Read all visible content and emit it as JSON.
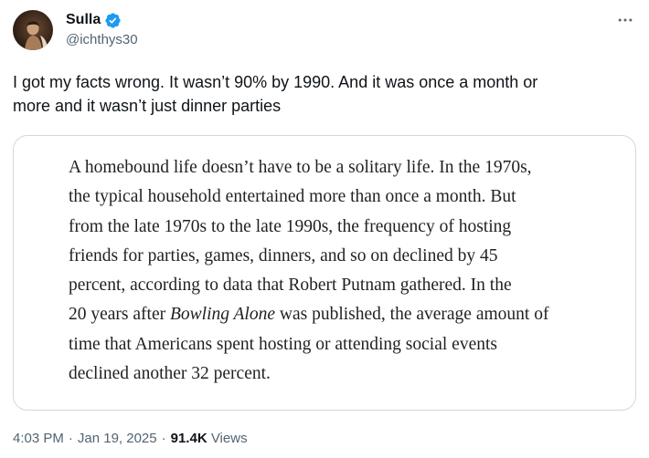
{
  "author": {
    "display_name": "Sulla",
    "handle": "@ichthys30",
    "verified_icon": "verified-badge-icon",
    "verified_color": "#1d9bf0"
  },
  "tweet": {
    "text_line_1": "I got my facts wrong. It wasn’t 90% by 1990. And it was once a month or",
    "text_line_2": "more and it wasn’t just dinner parties"
  },
  "media": {
    "excerpt_lines": [
      "A homebound life doesn’t have to be a solitary life. In the 1970s,",
      "the typical household entertained more than once a month. But",
      "from the late 1970s to the late 1990s, the frequency of hosting",
      "friends for parties, games, dinners, and so on declined by 45",
      "percent, according to data that Robert Putnam gathered. In the"
    ],
    "line6_before": "20 years after ",
    "line6_book": "Bowling Alone",
    "line6_after": " was published, the average amount of",
    "excerpt_lines_end": [
      "time that Americans spent hosting or attending social events",
      "declined another 32 percent."
    ]
  },
  "meta": {
    "time": "4:03 PM",
    "date": "Jan 19, 2025",
    "separator": "·",
    "views_count": "91.4K",
    "views_label": "Views"
  },
  "colors": {
    "text": "#0f1419",
    "secondary_text": "#536471",
    "border": "#cfd9de",
    "accent": "#1d9bf0"
  }
}
